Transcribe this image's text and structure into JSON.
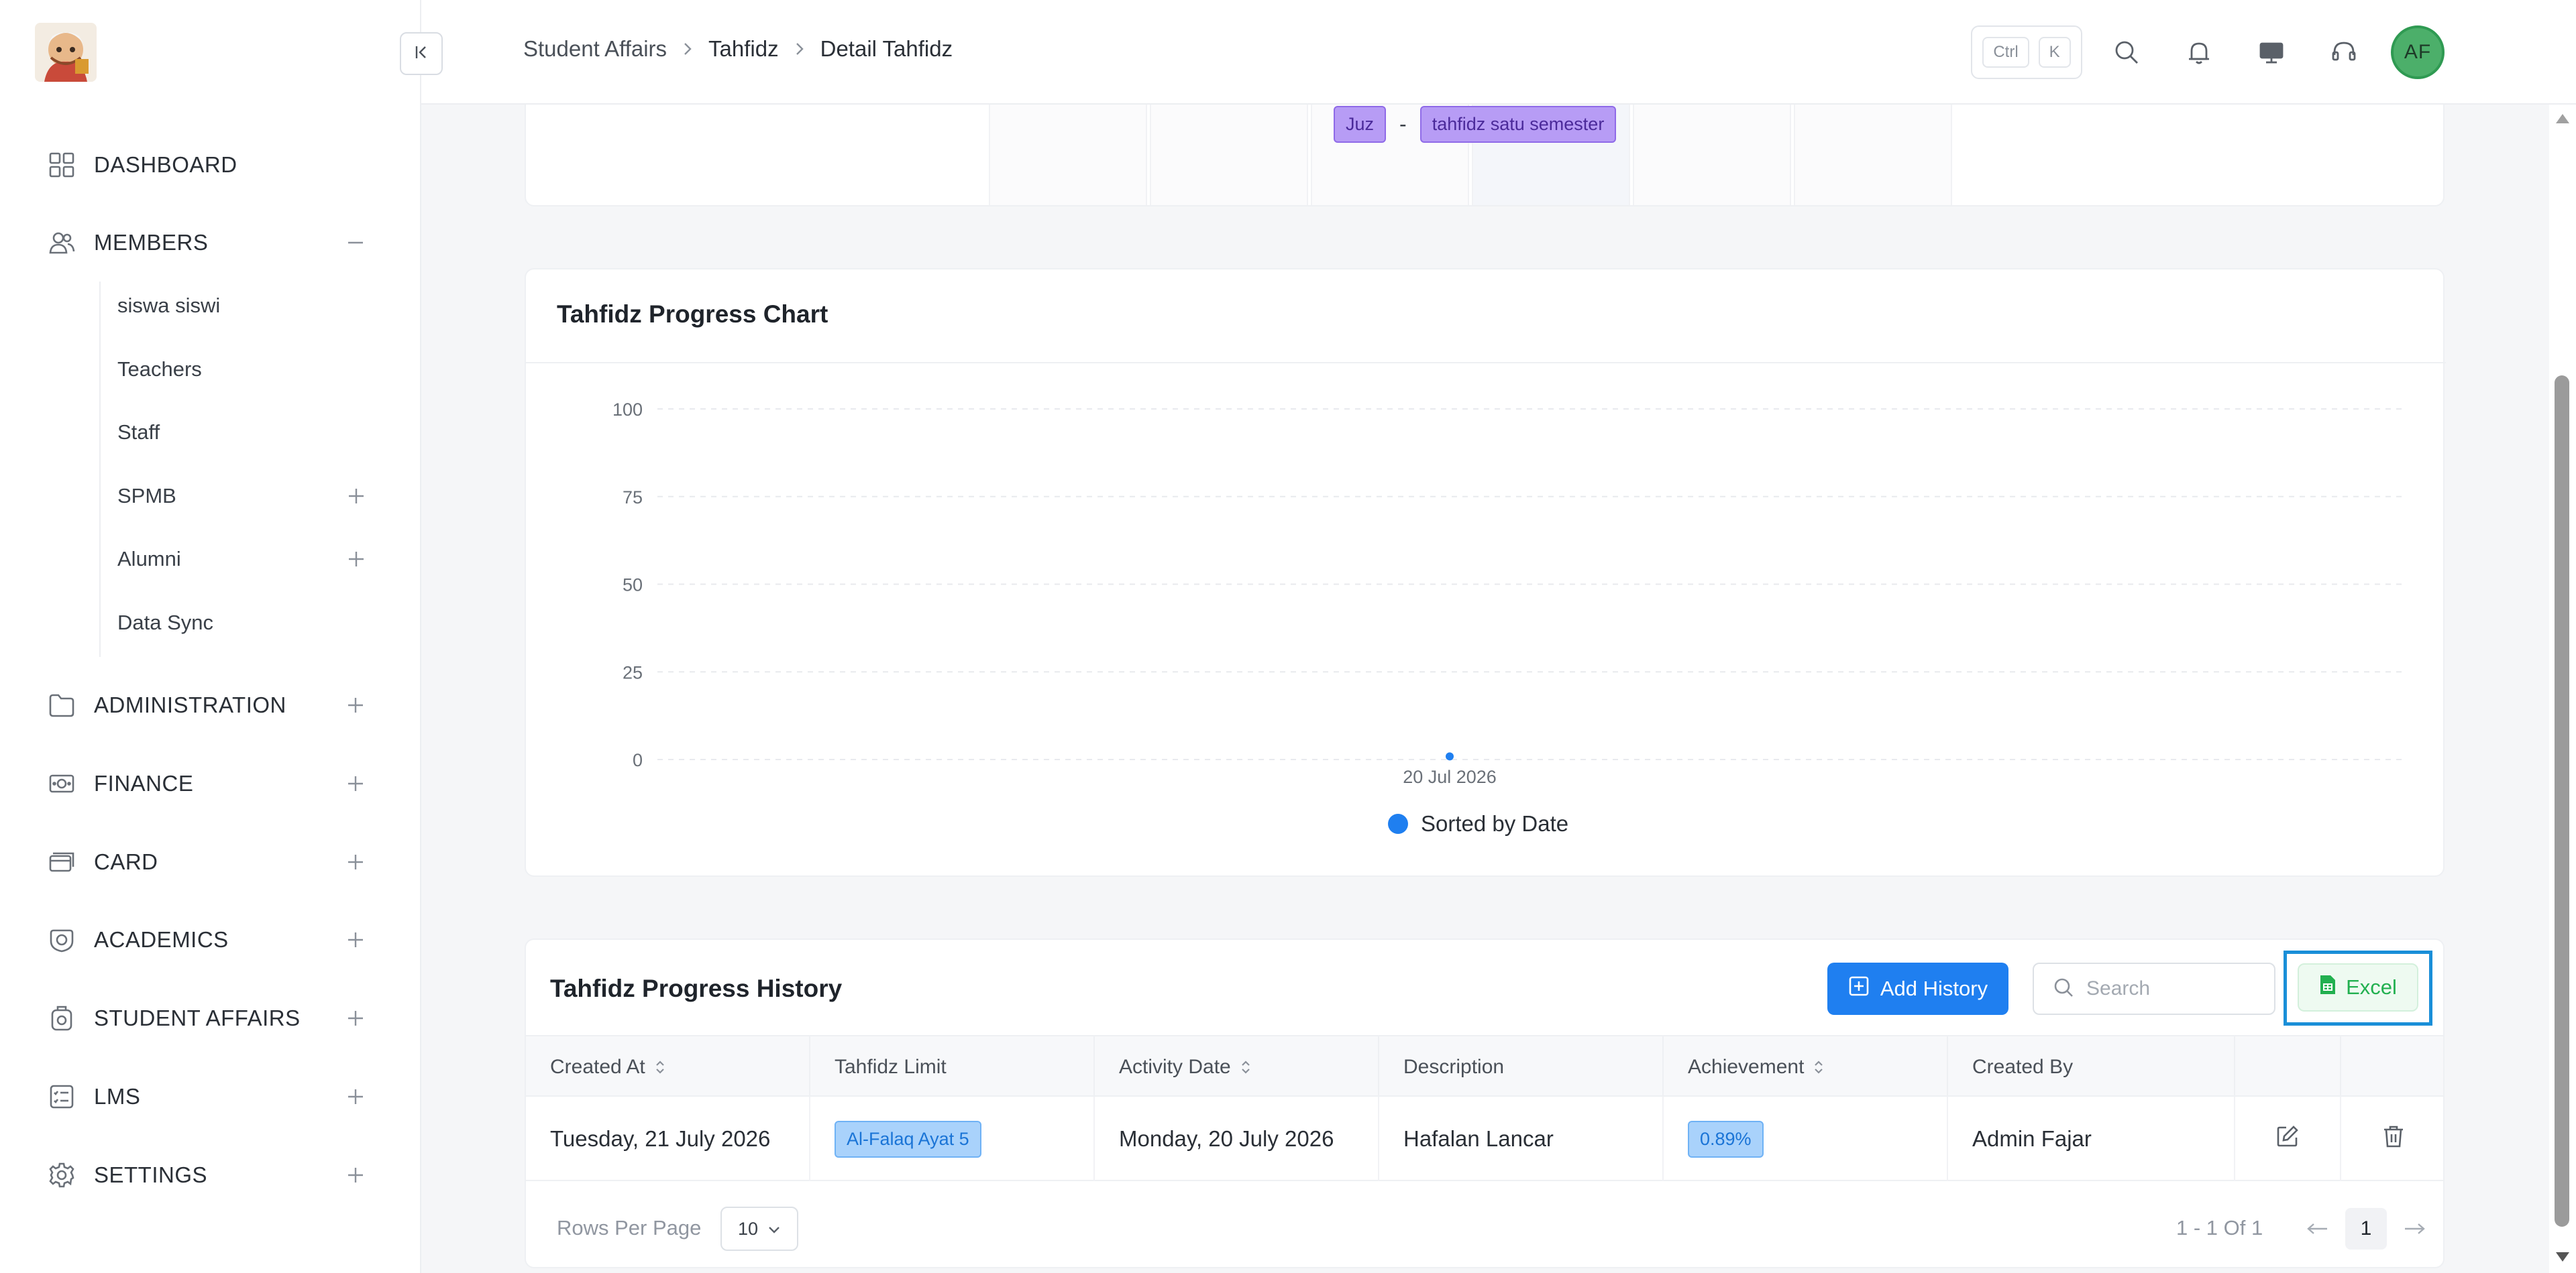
{
  "sidebar": {
    "nav": [
      {
        "label": "DASHBOARD",
        "icon": "dashboard-grid-icon"
      },
      {
        "label": "MEMBERS",
        "icon": "members-icon",
        "expanded": true
      },
      {
        "label": "ADMINISTRATION",
        "icon": "folder-icon"
      },
      {
        "label": "FINANCE",
        "icon": "money-icon"
      },
      {
        "label": "CARD",
        "icon": "card-icon"
      },
      {
        "label": "ACADEMICS",
        "icon": "academics-icon"
      },
      {
        "label": "STUDENT AFFAIRS",
        "icon": "student-affairs-icon"
      },
      {
        "label": "LMS",
        "icon": "lms-icon"
      },
      {
        "label": "SETTINGS",
        "icon": "gear-icon"
      }
    ],
    "members_sub": [
      "siswa siswi",
      "Teachers",
      "Staff",
      "SPMB",
      "Alumni",
      "Data Sync"
    ]
  },
  "header": {
    "breadcrumb": [
      "Student Affairs",
      "Tahfidz",
      "Detail Tahfidz"
    ],
    "shortcut_keys": [
      "Ctrl",
      "K"
    ],
    "avatar_initials": "AF"
  },
  "top_card": {
    "tag_left": "Juz",
    "tag_sep": "-",
    "tag_right": "tahfidz satu semester"
  },
  "chart_card": {
    "title": "Tahfidz Progress Chart"
  },
  "chart_data": {
    "type": "line",
    "categories": [
      "20 Jul 2026"
    ],
    "series": [
      {
        "name": "Sorted by Date",
        "values": [
          0.89
        ]
      }
    ],
    "ylim": [
      0,
      100
    ],
    "yticks": [
      0,
      25,
      50,
      75,
      100
    ],
    "grid": true,
    "legend": "bottom-center",
    "color": "#1f7ff0"
  },
  "history": {
    "title": "Tahfidz Progress History",
    "add_label": "Add History",
    "search_placeholder": "Search",
    "excel_label": "Excel",
    "columns": [
      "Created At",
      "Tahfidz Limit",
      "Activity Date",
      "Description",
      "Achievement",
      "Created By"
    ],
    "rows": [
      {
        "created_at": "Tuesday, 21 July 2026",
        "limit": "Al-Falaq Ayat 5",
        "activity_date": "Monday, 20 July 2026",
        "description": "Hafalan Lancar",
        "achievement": "0.89%",
        "created_by": "Admin Fajar"
      }
    ],
    "rows_per_page_label": "Rows Per Page",
    "rows_per_page": "10",
    "page_info": "1 - 1 Of 1",
    "page": "1"
  }
}
